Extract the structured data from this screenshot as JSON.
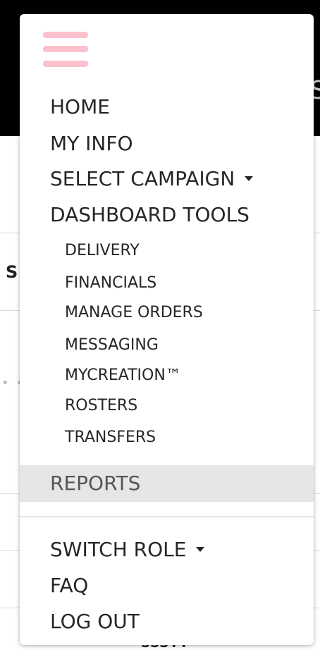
{
  "background": {
    "header_fragment": "S",
    "side_fragment": "S",
    "dots": "• • •",
    "bottom_fragment": "SSSYY"
  },
  "menu": {
    "toggle_icon": "hamburger-icon",
    "toggle_color": "#fcc1cc",
    "items": {
      "home": "HOME",
      "my_info": "MY INFO",
      "select_campaign": "SELECT CAMPAIGN",
      "dashboard_tools": "DASHBOARD TOOLS"
    },
    "dashboard_subitems": {
      "delivery": "DELIVERY",
      "financials": "FINANCIALS",
      "manage_orders": "MANAGE ORDERS",
      "messaging": "MESSAGING",
      "mycreation": "MYCREATION™",
      "rosters": "ROSTERS",
      "transfers": "TRANSFERS"
    },
    "reports": "REPORTS",
    "footer_items": {
      "switch_role": "SWITCH ROLE",
      "faq": "FAQ",
      "log_out": "LOG OUT"
    },
    "active_highlight_color": "#e6e6e6"
  }
}
